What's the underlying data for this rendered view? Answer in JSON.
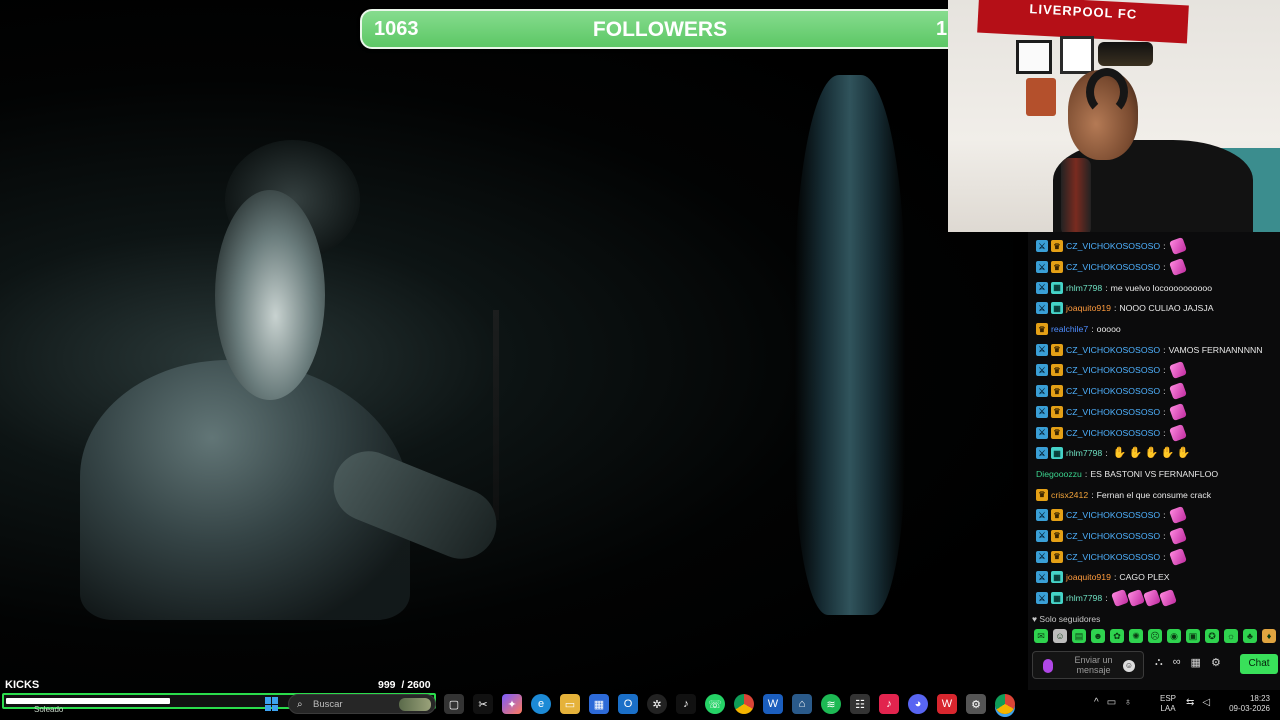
{
  "followers": {
    "current": "1063",
    "label": "FOLLOWERS",
    "goal": "1"
  },
  "webcam": {
    "banner": "LIVERPOOL FC"
  },
  "chat": {
    "messages": [
      {
        "user": "CZ_VICHOKOSOSOSO",
        "color": "#4fb2ff",
        "badges": [
          "moder",
          "sub"
        ],
        "text": "",
        "emotes": 1,
        "emote_type": "pink"
      },
      {
        "user": "CZ_VICHOKOSOSOSO",
        "color": "#4fb2ff",
        "badges": [
          "moder",
          "sub"
        ],
        "text": "",
        "emotes": 1,
        "emote_type": "pink"
      },
      {
        "user": "rhlm7798",
        "color": "#6fe3c4",
        "badges": [
          "moder",
          "gift"
        ],
        "text": "me vuelvo locoooooooooo",
        "emotes": 0
      },
      {
        "user": "joaquito919",
        "color": "#ff9b3d",
        "badges": [
          "moder",
          "gift"
        ],
        "text": "NOOO CULIAO JAJSJA",
        "emotes": 0
      },
      {
        "user": "realchile7",
        "color": "#4f8dff",
        "badges": [
          "sub"
        ],
        "text": "ooooo",
        "emotes": 0
      },
      {
        "user": "CZ_VICHOKOSOSOSO",
        "color": "#4fb2ff",
        "badges": [
          "moder",
          "sub"
        ],
        "text": "VAMOS FERNANNNNN",
        "emotes": 0
      },
      {
        "user": "CZ_VICHOKOSOSOSO",
        "color": "#4fb2ff",
        "badges": [
          "moder",
          "sub"
        ],
        "text": "",
        "emotes": 1,
        "emote_type": "pink"
      },
      {
        "user": "CZ_VICHOKOSOSOSO",
        "color": "#4fb2ff",
        "badges": [
          "moder",
          "sub"
        ],
        "text": "",
        "emotes": 1,
        "emote_type": "pink"
      },
      {
        "user": "CZ_VICHOKOSOSOSO",
        "color": "#4fb2ff",
        "badges": [
          "moder",
          "sub"
        ],
        "text": "",
        "emotes": 1,
        "emote_type": "pink"
      },
      {
        "user": "CZ_VICHOKOSOSOSO",
        "color": "#4fb2ff",
        "badges": [
          "moder",
          "sub"
        ],
        "text": "",
        "emotes": 1,
        "emote_type": "pink"
      },
      {
        "user": "rhlm7798",
        "color": "#6fe3c4",
        "badges": [
          "moder",
          "gift"
        ],
        "text": "",
        "emotes": 5,
        "emote_type": "hand"
      },
      {
        "user": "Diegooozzu",
        "color": "#3bd48e",
        "badges": [],
        "text": "ES BASTONI VS FERNANFLOO",
        "emotes": 0
      },
      {
        "user": "crisx2412",
        "color": "#f2a33a",
        "badges": [
          "sub"
        ],
        "text": "Fernan el que consume crack",
        "emotes": 0
      },
      {
        "user": "CZ_VICHOKOSOSOSO",
        "color": "#4fb2ff",
        "badges": [
          "moder",
          "sub"
        ],
        "text": "",
        "emotes": 1,
        "emote_type": "pink"
      },
      {
        "user": "CZ_VICHOKOSOSOSO",
        "color": "#4fb2ff",
        "badges": [
          "moder",
          "sub"
        ],
        "text": "",
        "emotes": 1,
        "emote_type": "pink"
      },
      {
        "user": "CZ_VICHOKOSOSOSO",
        "color": "#4fb2ff",
        "badges": [
          "moder",
          "sub"
        ],
        "text": "",
        "emotes": 1,
        "emote_type": "pink"
      },
      {
        "user": "joaquito919",
        "color": "#ff9b3d",
        "badges": [
          "moder",
          "gift"
        ],
        "text": "CAGO PLEX",
        "emotes": 0
      },
      {
        "user": "rhlm7798",
        "color": "#6fe3c4",
        "badges": [
          "moder",
          "gift"
        ],
        "text": "",
        "emotes": 4,
        "emote_type": "pink"
      }
    ],
    "followers_only": "Solo seguidores",
    "input_placeholder": "Enviar un mensaje",
    "send_label": "Chat"
  },
  "kicks": {
    "label": "KICKS",
    "count": "999",
    "goal": "/ 2600",
    "progress": 0.384,
    "weather": "Soleado"
  },
  "taskbar": {
    "search_placeholder": "Buscar",
    "lang_line1": "ESP",
    "lang_line2": "LAA",
    "time": "18:23",
    "date": "09-03-2026"
  },
  "colors": {
    "accent_green": "#39e05a",
    "followers_bar": "#5cc765",
    "moderator_badge": "#3a9fd6",
    "subscriber_badge": "#e4a016"
  }
}
